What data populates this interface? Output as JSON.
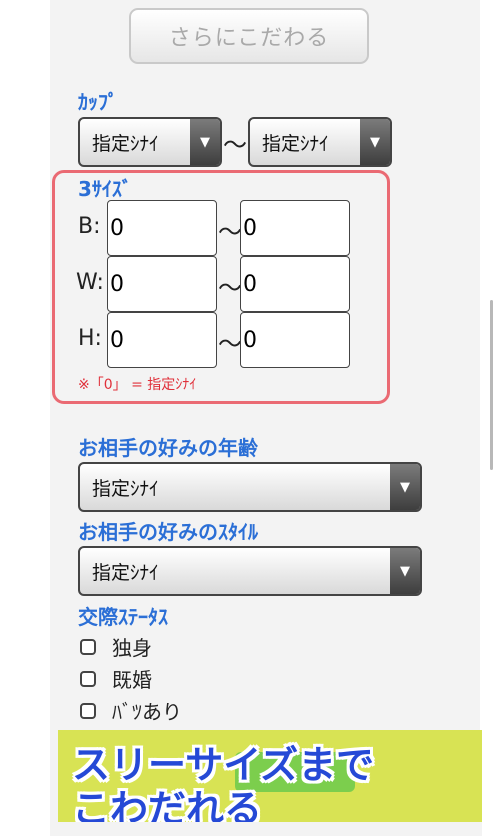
{
  "buttons": {
    "more_filters": "さらにこだわる"
  },
  "cup": {
    "label": "ｶｯﾌﾟ",
    "from": "指定ｼﾅｲ",
    "to": "指定ｼﾅｲ",
    "separator": "〜"
  },
  "three_size": {
    "label": "3ｻｲｽﾞ",
    "rows": [
      {
        "label": "B:",
        "min": "0",
        "max": "0"
      },
      {
        "label": "W:",
        "min": "0",
        "max": "0"
      },
      {
        "label": "H:",
        "min": "0",
        "max": "0"
      }
    ],
    "separator": "〜",
    "note": "※「0」 = 指定ｼﾅｲ"
  },
  "partner_age": {
    "label": "お相手の好みの年齢",
    "value": "指定ｼﾅｲ"
  },
  "partner_style": {
    "label": "お相手の好みのｽﾀｲﾙ",
    "value": "指定ｼﾅｲ"
  },
  "relationship": {
    "label": "交際ｽﾃｰﾀｽ",
    "options": [
      {
        "label": "独身",
        "checked": false
      },
      {
        "label": "既婚",
        "checked": false
      },
      {
        "label": "ﾊﾞﾂあり",
        "checked": false
      }
    ]
  },
  "banner": {
    "line1": "スリーサイズまで",
    "line2": "こわだれる"
  },
  "colors": {
    "accent_blue": "#2b6fd6",
    "highlight_red": "#ea6a73",
    "banner_yellow": "#d8e354"
  }
}
